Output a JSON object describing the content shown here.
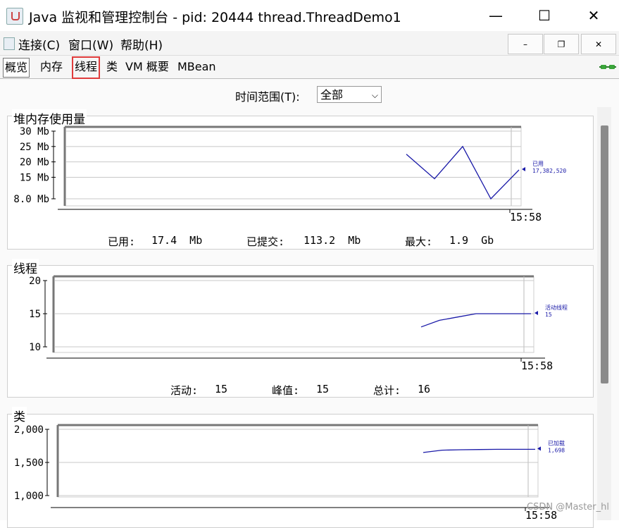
{
  "window": {
    "title": "Java 监视和管理控制台 - pid: 20444 thread.ThreadDemo1",
    "controls": {
      "minimize": "—",
      "maximize": "☐",
      "close": "✕"
    }
  },
  "menu": {
    "connect": "连接(C)",
    "window": "窗口(W)",
    "help": "帮助(H)"
  },
  "mdi_controls": {
    "minimize": "–",
    "restore": "❐",
    "close": "✕"
  },
  "tabs": [
    "概览",
    "内存",
    "线程",
    "类",
    "VM 概要",
    "MBean"
  ],
  "active_tab": "概览",
  "highlighted_tab": "线程",
  "time_range": {
    "label": "时间范围(T):",
    "value": "全部"
  },
  "panels": {
    "heap": {
      "title": "堆内存使用量",
      "stats": {
        "used_label": "已用:",
        "used_value": "17.4  Mb",
        "committed_label": "已提交:",
        "committed_value": "113.2  Mb",
        "max_label": "最大:",
        "max_value": "1.9  Gb"
      }
    },
    "threads": {
      "title": "线程",
      "stats": {
        "live_label": "活动:",
        "live_value": "15",
        "peak_label": "峰值:",
        "peak_value": "15",
        "total_label": "总计:",
        "total_value": "16"
      }
    },
    "classes": {
      "title": "类"
    }
  },
  "chart_data": [
    {
      "type": "line",
      "title": "堆内存使用量",
      "y_ticks": [
        "30 Mb",
        "25 Mb",
        "20 Mb",
        "15 Mb",
        "8.0 Mb"
      ],
      "y_tick_values": [
        30,
        25,
        20,
        15,
        8
      ],
      "ylim": [
        8,
        30
      ],
      "x_tick": "15:58",
      "series": [
        {
          "name": "已用",
          "values": [
            22.5,
            14.5,
            25,
            8,
            17.4
          ]
        }
      ],
      "legend_value": "17,382,520",
      "color": "#1a1aa8"
    },
    {
      "type": "line",
      "title": "线程",
      "y_ticks": [
        "20",
        "15",
        "10"
      ],
      "y_tick_values": [
        20,
        15,
        10
      ],
      "ylim": [
        10,
        20
      ],
      "x_tick": "15:58",
      "series": [
        {
          "name": "活动线程",
          "values": [
            13,
            14,
            14.5,
            15,
            15,
            15,
            15
          ]
        }
      ],
      "legend_value": "15",
      "color": "#1a1aa8"
    },
    {
      "type": "line",
      "title": "类",
      "y_ticks": [
        "2,000",
        "1,500",
        "1,000"
      ],
      "y_tick_values": [
        2000,
        1500,
        1000
      ],
      "ylim": [
        1000,
        2000
      ],
      "x_tick": "15:58",
      "series": [
        {
          "name": "已加载",
          "values": [
            1650,
            1685,
            1692,
            1695,
            1698,
            1698,
            1698
          ]
        }
      ],
      "legend_value": "1,698",
      "color": "#1a1aa8"
    }
  ],
  "watermark": "CSDN @Master_hl"
}
